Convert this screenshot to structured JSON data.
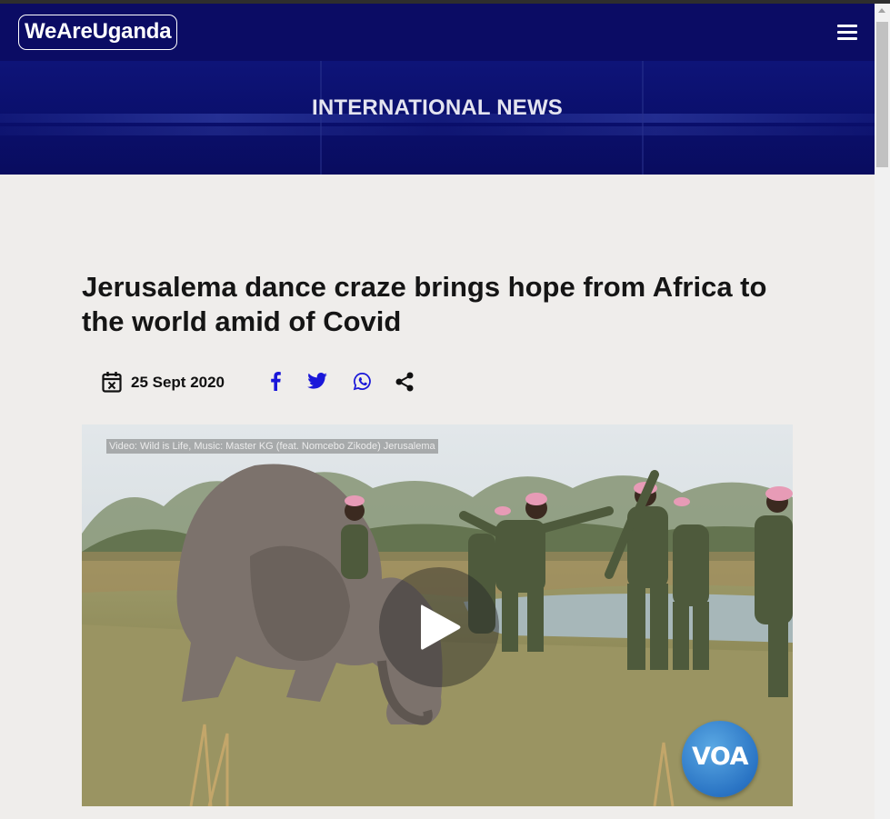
{
  "site": {
    "logo_text": "WeAreUganda"
  },
  "navbar": {
    "menu_icon": "hamburger-menu-icon",
    "background_color": "#0b0c64"
  },
  "hero": {
    "title": "INTERNATIONAL NEWS"
  },
  "article": {
    "headline": "Jerusalema dance craze brings hope from Africa to the world amid of Covid",
    "date": "25 Sept 2020",
    "date_icon": "calendar-icon",
    "share_buttons": [
      {
        "name": "facebook-icon",
        "color": "#1a17d9"
      },
      {
        "name": "twitter-icon",
        "color": "#1a17d9"
      },
      {
        "name": "whatsapp-icon",
        "color": "#1a17d9"
      },
      {
        "name": "share-icon",
        "color": "#111111"
      }
    ]
  },
  "video": {
    "caption": "Video: Wild is Life, Music: Master KG (feat. Nomcebo Zikode) Jerusalema",
    "play_icon": "play-icon",
    "watermark": "VOA"
  }
}
